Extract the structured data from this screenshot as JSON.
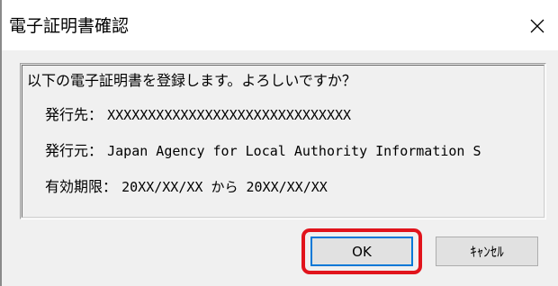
{
  "window": {
    "title": "電子証明書確認",
    "close_icon": "close-icon"
  },
  "info": {
    "question": "以下の電子証明書を登録します。よろしいですか？",
    "issued_to_label": "発行先：",
    "issued_to_value": "XXXXXXXXXXXXXXXXXXXXXXXXXXXXXX",
    "issuer_label": "発行元：",
    "issuer_value": "Japan Agency for Local Authority Information S",
    "validity_label": "有効期限：",
    "validity_value": "20XX/XX/XX から 20XX/XX/XX"
  },
  "buttons": {
    "ok_label": "OK",
    "cancel_label": "ｷｬﾝｾﾙ"
  },
  "colors": {
    "highlight": "#e1141c",
    "focus_border": "#0078d7",
    "dialog_bg": "#f0f0f0"
  }
}
